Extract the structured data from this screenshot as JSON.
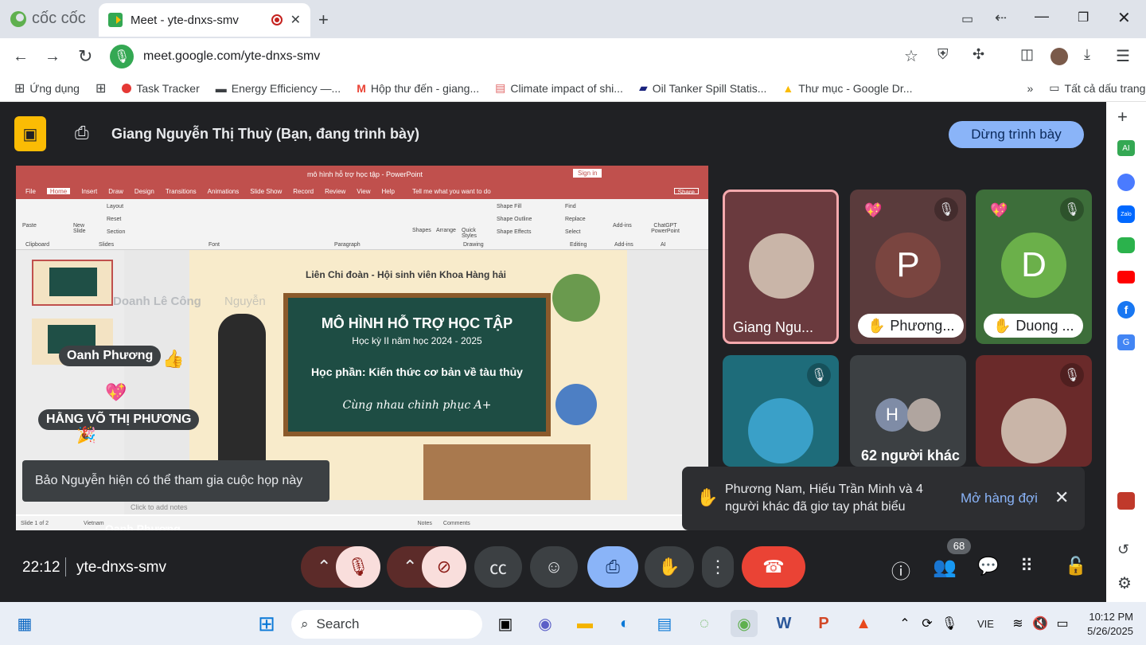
{
  "browser": {
    "brand_name": "cốc cốc",
    "tab_title": "Meet - yte-dnxs-smv",
    "url": "meet.google.com/yte-dnxs-smv",
    "bookmarks": [
      {
        "label": "Ứng dụng"
      },
      {
        "label": "Task Tracker"
      },
      {
        "label": "Energy Efficiency —..."
      },
      {
        "label": "Hộp thư đến - giang..."
      },
      {
        "label": "Climate impact of shi..."
      },
      {
        "label": "Oil Tanker Spill Statis..."
      },
      {
        "label": "Thư mục - Google Dr..."
      }
    ],
    "all_bookmarks": "Tất cả dấu trang"
  },
  "meet": {
    "presenting_text": "Giang Nguyễn Thị Thuỳ (Bạn, đang trình bày)",
    "stop_presenting": "Dừng trình bày",
    "time": "22:12",
    "meeting_code": "yte-dnxs-smv",
    "participant_count": "68",
    "toast": "Bảo Nguyễn hiện có thể tham gia cuộc họp này",
    "raise_notice": "Phương Nam, Hiếu Trần Minh và 4 người khác đã giơ tay phát biểu",
    "open_queue": "Mở hàng đợi",
    "tiles": [
      {
        "name": "Giang Ngu...",
        "initial": ""
      },
      {
        "name": "Phương...",
        "initial": "P"
      },
      {
        "name": "Duong ...",
        "initial": "D"
      },
      {
        "name": "",
        "initial": ""
      },
      {
        "name": "62 người khác",
        "initial": "H"
      },
      {
        "name": "",
        "initial": ""
      }
    ],
    "floating_names": [
      "Doanh Lê Công",
      "Nguyễn",
      "Oanh Phương",
      "HẰNG VÕ THỊ PHƯƠNG",
      "Oanh Phương"
    ]
  },
  "ppt": {
    "title": "mô hình hỗ trợ học tập - PowerPoint",
    "sign_in": "Sign in",
    "tabs": [
      "File",
      "Home",
      "Insert",
      "Draw",
      "Design",
      "Transitions",
      "Animations",
      "Slide Show",
      "Record",
      "Review",
      "View",
      "Help"
    ],
    "tell_me": "Tell me what you want to do",
    "share": "Share",
    "groups": [
      "Clipboard",
      "Slides",
      "Font",
      "Paragraph",
      "Drawing",
      "Editing",
      "Add-ins",
      "AI"
    ],
    "ribbon_labels": [
      "Paste",
      "New Slide",
      "Layout",
      "Reset",
      "Section",
      "Shapes",
      "Arrange",
      "Quick Styles",
      "Shape Fill",
      "Shape Outline",
      "Shape Effects",
      "Find",
      "Replace",
      "Select",
      "Add-ins",
      "ChatGPT PowerPoint"
    ],
    "slide_header": "Liên Chi đoàn - Hội sinh viên Khoa Hàng hải",
    "slide_title": "MÔ HÌNH HỖ TRỢ HỌC TẬP",
    "slide_sub": "Học kỳ II năm học 2024 - 2025",
    "slide_course": "Học phần: Kiến thức cơ bản về tàu thủy",
    "slide_motto": "Cùng nhau chinh phục A+",
    "status_slide": "Slide 1 of 2",
    "status_lang": "Vietnam",
    "notes": "Notes",
    "comments": "Comments",
    "click_add": "Click to add notes"
  },
  "taskbar": {
    "search": "Search",
    "lang": "VIE",
    "time": "10:12 PM",
    "date": "5/26/2025"
  },
  "colors": {
    "accent": "#8ab4f8",
    "end_call": "#ea4335",
    "muted": "#f9dedc"
  }
}
